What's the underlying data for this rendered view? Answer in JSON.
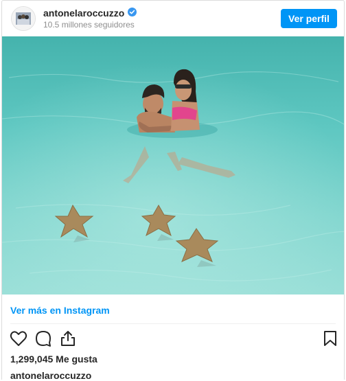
{
  "header": {
    "username": "antonelaroccuzzo",
    "followers": "10.5 millones seguidores",
    "profile_button": "Ver perfil"
  },
  "post": {
    "more_link": "Ver más en Instagram",
    "likes": "1,299,045 Me gusta",
    "caption_username": "antonelaroccuzzo"
  },
  "icons": {
    "verified": "verified-badge-icon",
    "like": "heart-icon",
    "comment": "comment-icon",
    "share": "share-icon",
    "save": "bookmark-icon"
  },
  "colors": {
    "accent": "#0095f6",
    "water": "#4dc4c4",
    "text": "#262626",
    "muted": "#8e8e8e"
  }
}
